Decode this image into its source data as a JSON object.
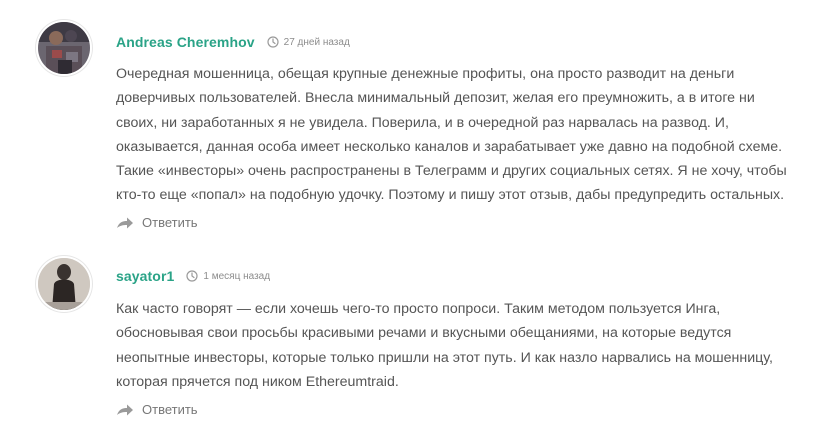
{
  "colors": {
    "author": "#2aa387",
    "text": "#555555",
    "meta": "#8c8c8c",
    "icon": "#9a9a9a"
  },
  "comments": [
    {
      "author": "Andreas Cheremhov",
      "time": "27 дней назад",
      "lines": [
        "Очередная мошенница, обещая крупные денежные профиты, она просто разводит на деньги",
        "доверчивых пользователей. Внесла минимальный депозит, желая его преумножить, а в итоге ни",
        "своих, ни заработанных я не увидела. Поверила, и в очередной раз нарвалась на развод. И,",
        "оказывается, данная особа имеет несколько каналов и зарабатывает уже давно на подобной схеме.",
        "Такие «инвесторы» очень распространены в Телеграмм и других социальных сетях. Я не хочу, чтобы",
        "кто-то еще «попал» на подобную удочку. Поэтому и пишу этот отзыв, дабы предупредить остальных."
      ],
      "reply_label": "Ответить",
      "avatar_icon": "user-photo-icon",
      "time_icon": "clock-icon",
      "reply_icon": "reply-arrow-icon"
    },
    {
      "author": "sayator1",
      "time": "1 месяц назад",
      "lines": [
        "Как часто говорят — если хочешь чего-то просто попроси. Таким методом пользуется Инга,",
        "обосновывая свои просьбы красивыми речами и вкусными обещаниями, на которые ведутся",
        "неопытные инвесторы, которые только пришли на этот путь. И как назло нарвались на мошенницу,",
        "которая прячется под ником Ethereumtraid."
      ],
      "reply_label": "Ответить",
      "avatar_icon": "user-photo-icon",
      "time_icon": "clock-icon",
      "reply_icon": "reply-arrow-icon"
    }
  ]
}
